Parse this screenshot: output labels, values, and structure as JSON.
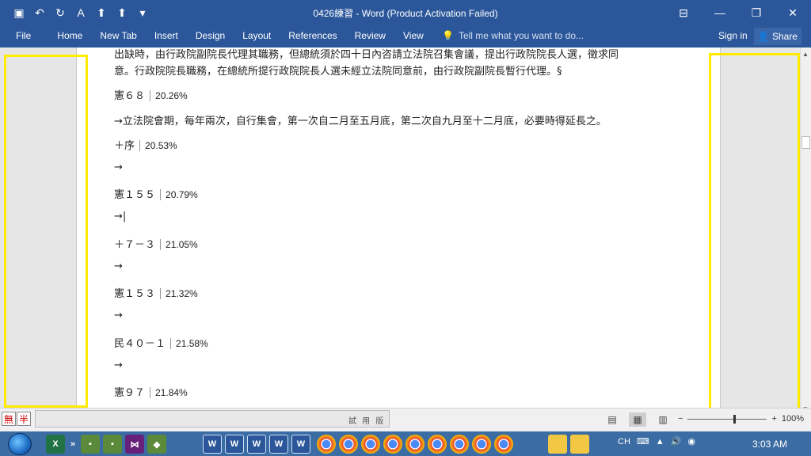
{
  "titlebar": {
    "title": "0426練習 - Word (Product Activation Failed)",
    "qat_icons": [
      "save-icon",
      "undo-icon",
      "redo-icon",
      "font-color-icon",
      "arrow-up-icon",
      "arrow-up-icon",
      "customize-icon"
    ]
  },
  "ribbon": {
    "tabs": [
      "File",
      "Home",
      "New Tab",
      "Insert",
      "Design",
      "Layout",
      "References",
      "Review",
      "View"
    ],
    "tell_me": "Tell me what you want to do...",
    "sign_in": "Sign in",
    "share": "Share"
  },
  "document": {
    "lines": [
      {
        "text": "出缺時，由行政院副院長代理其職務，但總統須於四十日內咨請立法院召集會議，提出行政院院長人選，徵求同",
        "pct": ""
      },
      {
        "text": "意。行政院院長職務，在總統所提行政院院長人選未經立法院同意前，由行政院副院長暫行代理。§",
        "pct": ""
      },
      {
        "text": "憲６８",
        "pct": "20.26%"
      },
      {
        "text": "→立法院會期，每年兩次，自行集會，第一次自二月至五月底，第二次自九月至十二月底，必要時得延長之。",
        "pct": ""
      },
      {
        "text": "＋序",
        "pct": "20.53%"
      },
      {
        "text": "→",
        "pct": ""
      },
      {
        "text": "憲１５５",
        "pct": "20.79%"
      },
      {
        "text": "→|",
        "pct": ""
      },
      {
        "text": "＋７－３",
        "pct": "21.05%"
      },
      {
        "text": "→",
        "pct": ""
      },
      {
        "text": "憲１５３",
        "pct": "21.32%"
      },
      {
        "text": "→",
        "pct": ""
      },
      {
        "text": "民４０－１",
        "pct": "21.58%"
      },
      {
        "text": "→",
        "pct": ""
      },
      {
        "text": "憲９７",
        "pct": "21.84%"
      }
    ]
  },
  "statusbar": {
    "ime": [
      "無",
      "半"
    ],
    "trial": "試 用 版",
    "zoom_minus": "−",
    "zoom_plus": "+",
    "zoom_level": "100%"
  },
  "taskbar": {
    "ime_lang": "CH",
    "clock": "3:03 AM"
  },
  "colors": {
    "accent": "#2b579a",
    "highlight": "#ffeb00"
  }
}
